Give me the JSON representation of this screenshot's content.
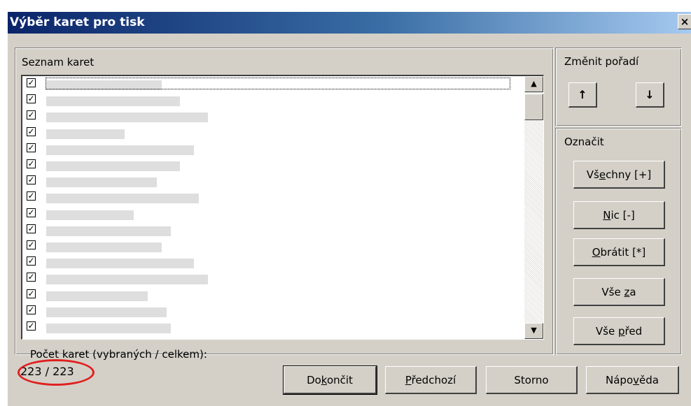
{
  "window": {
    "title": "Výběr karet pro tisk",
    "close_symbol": "×"
  },
  "list_group": {
    "label": "Seznam karet",
    "items": [
      {
        "checked": true,
        "mark": "✓",
        "bar_len": 0.25
      },
      {
        "checked": true,
        "mark": "✓",
        "bar_len": 0.29
      },
      {
        "checked": true,
        "mark": "✓",
        "bar_len": 0.35
      },
      {
        "checked": true,
        "mark": "✓",
        "bar_len": 0.17
      },
      {
        "checked": true,
        "mark": "✓",
        "bar_len": 0.32
      },
      {
        "checked": true,
        "mark": "✓",
        "bar_len": 0.29
      },
      {
        "checked": true,
        "mark": "✓",
        "bar_len": 0.24
      },
      {
        "checked": true,
        "mark": "✓",
        "bar_len": 0.33
      },
      {
        "checked": true,
        "mark": "✓",
        "bar_len": 0.19
      },
      {
        "checked": true,
        "mark": "✓",
        "bar_len": 0.27
      },
      {
        "checked": true,
        "mark": "✓",
        "bar_len": 0.25
      },
      {
        "checked": true,
        "mark": "✓",
        "bar_len": 0.32
      },
      {
        "checked": true,
        "mark": "✓",
        "bar_len": 0.35
      },
      {
        "checked": true,
        "mark": "✓",
        "bar_len": 0.22
      },
      {
        "checked": true,
        "mark": "✓",
        "bar_len": 0.26
      },
      {
        "checked": true,
        "mark": "✓",
        "bar_len": 0.27
      }
    ],
    "scroll_up_icon": "▲",
    "scroll_down_icon": "▼"
  },
  "order_group": {
    "label": "Změnit pořadí",
    "up_icon": "↑",
    "down_icon": "↓"
  },
  "mark_group": {
    "label": "Označit",
    "buttons": {
      "all": {
        "pre": "Vš",
        "ul": "e",
        "post": "chny [+]"
      },
      "none": {
        "pre": "",
        "ul": "N",
        "post": "ic [-]"
      },
      "invert": {
        "pre": "",
        "ul": "O",
        "post": "brátit [*]"
      },
      "all_after": {
        "pre": "Vše ",
        "ul": "z",
        "post": "a"
      },
      "all_before": {
        "pre": "Vše ",
        "ul": "p",
        "post": "řed"
      }
    }
  },
  "footer": {
    "count_label": "Počet karet (vybraných / celkem):",
    "count_value": "223 / 223",
    "buttons": {
      "finish": {
        "pre": "Do",
        "ul": "k",
        "post": "ončit"
      },
      "previous": {
        "pre": "",
        "ul": "P",
        "post": "ředchozí"
      },
      "cancel": "Storno",
      "help": {
        "pre": "Nápo",
        "ul": "v",
        "post": "ěda"
      }
    }
  },
  "colors": {
    "dialog_bg": "#d4d0c8",
    "title_gradient_start": "#0a246a",
    "title_gradient_end": "#a6caf0",
    "highlight_ellipse": "#e02020"
  }
}
